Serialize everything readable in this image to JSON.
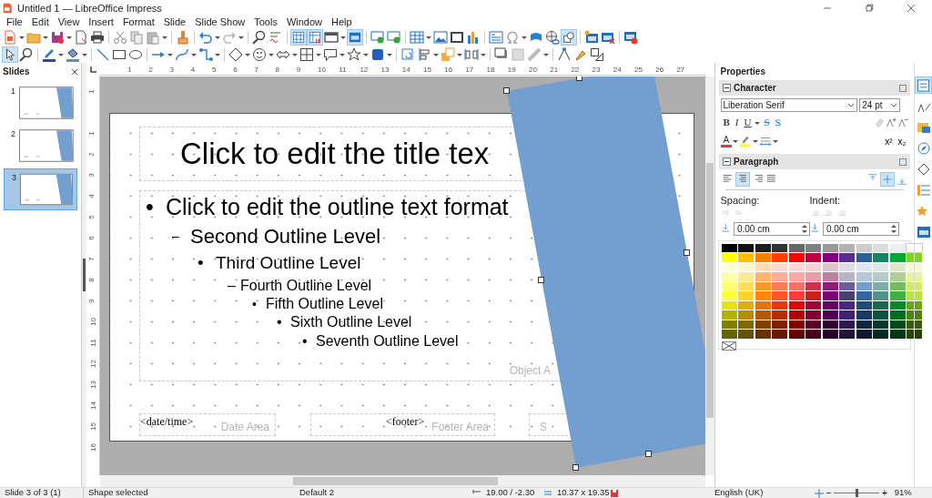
{
  "window": {
    "title": "Untitled 1 — LibreOffice Impress"
  },
  "menu": [
    "File",
    "Edit",
    "View",
    "Insert",
    "Format",
    "Slide",
    "Slide Show",
    "Tools",
    "Window",
    "Help"
  ],
  "toolbars": [
    {
      "buttons": [
        {
          "selected": false
        },
        {
          "selected": false
        },
        {
          "selected": false
        },
        {
          "selected": false
        },
        {
          "selected": false
        },
        {
          "selected": false
        },
        {
          "selected": false
        },
        {
          "selected": false
        },
        {
          "selected": false
        },
        {
          "selected": false
        },
        {
          "selected": false
        },
        {
          "selected": false
        },
        {
          "selected": false
        },
        {
          "selected": true
        },
        {
          "selected": true
        },
        {
          "selected": false
        },
        {
          "selected": true
        },
        {
          "selected": false
        },
        {
          "selected": false
        },
        {
          "selected": false
        },
        {
          "selected": false
        },
        {
          "selected": false
        },
        {
          "selected": false
        },
        {
          "selected": false
        },
        {
          "selected": false
        },
        {
          "selected": false
        },
        {
          "selected": false
        },
        {
          "selected": true
        },
        {
          "selected": false
        },
        {
          "selected": false
        },
        {
          "selected": false
        }
      ]
    },
    {
      "buttons": [
        {
          "selected": true
        },
        {
          "selected": false
        },
        {
          "selected": false
        },
        {
          "selected": false
        },
        {
          "selected": false
        },
        {
          "selected": false
        },
        {
          "selected": false
        },
        {
          "selected": false
        },
        {
          "selected": false
        },
        {
          "selected": false
        },
        {
          "selected": false
        },
        {
          "selected": false
        },
        {
          "selected": false
        },
        {
          "selected": false
        },
        {
          "selected": false
        },
        {
          "selected": false
        },
        {
          "selected": false
        },
        {
          "selected": false
        },
        {
          "selected": false
        },
        {
          "selected": false
        },
        {
          "selected": false
        },
        {
          "selected": false
        },
        {
          "selected": false
        },
        {
          "selected": false
        },
        {
          "selected": false
        },
        {
          "selected": false
        },
        {
          "selected": false
        }
      ]
    }
  ],
  "slides_panel": {
    "title": "Slides",
    "slides": [
      {
        "number": "1",
        "selected": false
      },
      {
        "number": "2",
        "selected": false
      },
      {
        "number": "3",
        "selected": true
      }
    ]
  },
  "rulers": {
    "horizontal": [
      "1",
      "2",
      "3",
      "4",
      "5",
      "6",
      "7",
      "8",
      "9",
      "10",
      "11",
      "12",
      "13",
      "14",
      "15",
      "16",
      "17",
      "18",
      "19",
      "20",
      "21",
      "22",
      "23",
      "24",
      "25",
      "26",
      "27"
    ],
    "vertical": [
      "1",
      "1",
      "2",
      "3",
      "4",
      "5",
      "6",
      "7",
      "8",
      "9",
      "10",
      "11",
      "12",
      "13",
      "14",
      "15",
      "16"
    ]
  },
  "slide": {
    "title": "Click to edit the title tex",
    "outline": [
      {
        "bullet": "•",
        "text": "Click to edit the outline text format",
        "children": [
          {
            "bullet": "–",
            "text": "Second Outline Level",
            "children": [
              {
                "bullet": "•",
                "text": "Third Outline Level",
                "children": [
                  {
                    "bullet": "–",
                    "text": "Fourth Outline Level",
                    "children": [
                      {
                        "bullet": "•",
                        "text": "Fifth Outline Level",
                        "children": [
                          {
                            "bullet": "•",
                            "text": "Sixth Outline Level",
                            "children": [
                              {
                                "bullet": "•",
                                "text": "Seventh Outline Level"
                              }
                            ]
                          }
                        ]
                      }
                    ]
                  }
                ]
              }
            ]
          }
        ]
      }
    ],
    "object_area": "Object A",
    "date": {
      "field": "<date/time>",
      "label": "Date Area"
    },
    "footer": {
      "field": "<footer>",
      "label": "Footer Area"
    },
    "number_area": "S"
  },
  "sidebar": {
    "title": "Properties",
    "character": {
      "title": "Character",
      "font": "Liberation Serif",
      "size": "24 pt",
      "format_buttons": [
        {
          "label": "B"
        },
        {
          "label": "I"
        },
        {
          "label": "U"
        },
        {
          "label": "S"
        },
        {
          "label": "S"
        }
      ],
      "font_color": "A",
      "scripts": [
        "x²",
        "x₂"
      ]
    },
    "paragraph": {
      "title": "Paragraph",
      "align": [
        {
          "selected": false
        },
        {
          "selected": true
        },
        {
          "selected": false
        },
        {
          "selected": false
        }
      ],
      "valign": [
        {
          "selected": false
        },
        {
          "selected": true
        },
        {
          "selected": false
        }
      ],
      "spacing_label": "Spacing:",
      "indent_label": "Indent:",
      "spacing_value": "0.00 cm",
      "indent_value": "0.00 cm"
    },
    "palette": [
      {
        "swatches": [
          {
            "color": "#000000"
          },
          {
            "color": "#111111"
          },
          {
            "color": "#1c1c1c"
          },
          {
            "color": "#333333"
          },
          {
            "color": "#666666"
          },
          {
            "color": "#808080"
          },
          {
            "color": "#999999"
          },
          {
            "color": "#b2b2b2"
          },
          {
            "color": "#cccccc"
          },
          {
            "color": "#dddddd"
          },
          {
            "color": "#eeeeee"
          },
          {
            "color": "#ffffff"
          }
        ]
      },
      {
        "swatches": [
          {
            "color": "#ffff00"
          },
          {
            "color": "#ffbf00"
          },
          {
            "color": "#ff8000"
          },
          {
            "color": "#ff4000"
          },
          {
            "color": "#ff0000"
          },
          {
            "color": "#bf0041"
          },
          {
            "color": "#800080"
          },
          {
            "color": "#55308d"
          },
          {
            "color": "#2a6099"
          },
          {
            "color": "#158466"
          },
          {
            "color": "#00a933"
          },
          {
            "color": "#81d41a"
          }
        ]
      },
      {
        "swatches": [
          {
            "color": "#ffffd7"
          },
          {
            "color": "#fff5ce"
          },
          {
            "color": "#ffdbb6"
          },
          {
            "color": "#ffd8ce"
          },
          {
            "color": "#ffd7d7"
          },
          {
            "color": "#f7d1d5"
          },
          {
            "color": "#e0c2cd"
          },
          {
            "color": "#dedce6"
          },
          {
            "color": "#dee6ef"
          },
          {
            "color": "#dee7e5"
          },
          {
            "color": "#dde8cb"
          },
          {
            "color": "#f6f9d4"
          }
        ]
      },
      {
        "swatches": [
          {
            "color": "#ffffa6"
          },
          {
            "color": "#ffe994"
          },
          {
            "color": "#ffb66c"
          },
          {
            "color": "#ffaa95"
          },
          {
            "color": "#ffa6a6"
          },
          {
            "color": "#ec9ba4"
          },
          {
            "color": "#bf819e"
          },
          {
            "color": "#b7b3ca"
          },
          {
            "color": "#b4c7dc"
          },
          {
            "color": "#b3cac7"
          },
          {
            "color": "#afd095"
          },
          {
            "color": "#e8f2a1"
          }
        ]
      },
      {
        "swatches": [
          {
            "color": "#ffff6d"
          },
          {
            "color": "#ffde59"
          },
          {
            "color": "#ff972f"
          },
          {
            "color": "#ff7b59"
          },
          {
            "color": "#ff6d6d"
          },
          {
            "color": "#d62e4e"
          },
          {
            "color": "#8d1d75"
          },
          {
            "color": "#6b5e9b"
          },
          {
            "color": "#729fcf"
          },
          {
            "color": "#81aca6"
          },
          {
            "color": "#77bc65"
          },
          {
            "color": "#d4ea6b"
          }
        ]
      },
      {
        "swatches": [
          {
            "color": "#ffff38"
          },
          {
            "color": "#ffd428"
          },
          {
            "color": "#ff860d"
          },
          {
            "color": "#ff5429"
          },
          {
            "color": "#ff3838"
          },
          {
            "color": "#c9211e"
          },
          {
            "color": "#780373"
          },
          {
            "color": "#483e70"
          },
          {
            "color": "#3465a4"
          },
          {
            "color": "#50938a"
          },
          {
            "color": "#3faf46"
          },
          {
            "color": "#bbe33d"
          }
        ]
      },
      {
        "swatches": [
          {
            "color": "#e6e600"
          },
          {
            "color": "#e6ac00"
          },
          {
            "color": "#e67300"
          },
          {
            "color": "#e63900"
          },
          {
            "color": "#e60000"
          },
          {
            "color": "#a5003a"
          },
          {
            "color": "#660066"
          },
          {
            "color": "#472780"
          },
          {
            "color": "#1e4b80"
          },
          {
            "color": "#116b53"
          },
          {
            "color": "#008a2b"
          },
          {
            "color": "#6da615"
          }
        ]
      },
      {
        "swatches": [
          {
            "color": "#b3b300"
          },
          {
            "color": "#b38f00"
          },
          {
            "color": "#b35900"
          },
          {
            "color": "#b32d00"
          },
          {
            "color": "#b30000"
          },
          {
            "color": "#800032"
          },
          {
            "color": "#4d004d"
          },
          {
            "color": "#3c2470"
          },
          {
            "color": "#173a66"
          },
          {
            "color": "#0d523f"
          },
          {
            "color": "#006b21"
          },
          {
            "color": "#55800f"
          }
        ]
      },
      {
        "swatches": [
          {
            "color": "#808000"
          },
          {
            "color": "#806600"
          },
          {
            "color": "#804000"
          },
          {
            "color": "#802000"
          },
          {
            "color": "#800000"
          },
          {
            "color": "#5c0024"
          },
          {
            "color": "#330033"
          },
          {
            "color": "#2a1a4f"
          },
          {
            "color": "#0f2640"
          },
          {
            "color": "#08382b"
          },
          {
            "color": "#004a17"
          },
          {
            "color": "#3b5a0a"
          }
        ]
      },
      {
        "swatches": [
          {
            "color": "#666600"
          },
          {
            "color": "#665200"
          },
          {
            "color": "#663300"
          },
          {
            "color": "#661a00"
          },
          {
            "color": "#660000"
          },
          {
            "color": "#4a001c"
          },
          {
            "color": "#260026"
          },
          {
            "color": "#1f133b"
          },
          {
            "color": "#0b1c30"
          },
          {
            "color": "#062a20"
          },
          {
            "color": "#003811"
          },
          {
            "color": "#2c4308"
          }
        ]
      }
    ],
    "tabs": [
      {
        "selected": true
      },
      {
        "selected": false
      },
      {
        "selected": false
      },
      {
        "selected": false
      },
      {
        "selected": false
      },
      {
        "selected": false
      },
      {
        "selected": false
      },
      {
        "selected": false
      }
    ]
  },
  "status_bar": {
    "slide": "Slide 3 of 3 (1)",
    "selection": "Shape selected",
    "master": "Default 2",
    "position": "19.00 / -2.30",
    "size": "10.37 x 19.35",
    "language": "English (UK)",
    "zoom_out": "−",
    "zoom_in": "+",
    "zoom_slider": {
      "level": 0.5
    },
    "zoom": "91%"
  }
}
